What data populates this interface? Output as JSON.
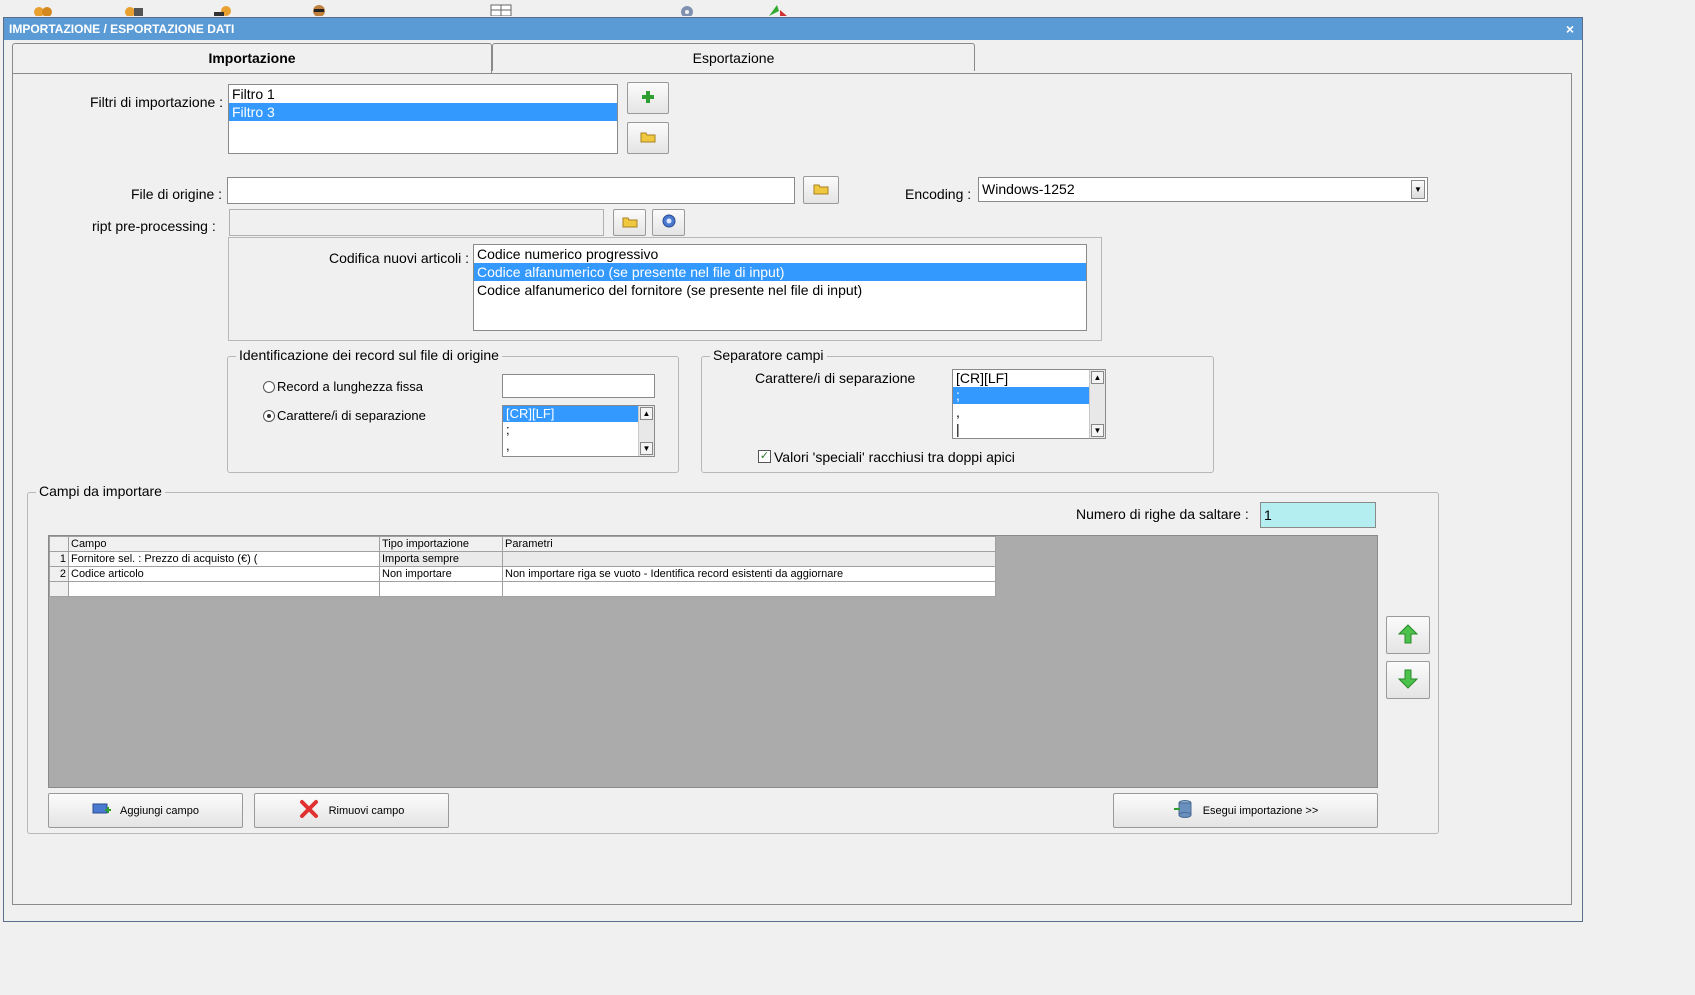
{
  "window": {
    "title": "IMPORTAZIONE / ESPORTAZIONE DATI",
    "close_label": "×"
  },
  "tabs": [
    {
      "label": "Importazione",
      "active": true
    },
    {
      "label": "Esportazione",
      "active": false
    }
  ],
  "filters": {
    "label": "Filtri di importazione :",
    "items": [
      "Filtro 1",
      "Filtro 3"
    ],
    "selected_index": 1
  },
  "source_file": {
    "label": "File di origine :",
    "value": ""
  },
  "encoding": {
    "label": "Encoding :",
    "value": "Windows-1252"
  },
  "script": {
    "label": "ript pre-processing :",
    "value": ""
  },
  "codifica": {
    "label": "Codifica nuovi articoli :",
    "items": [
      "Codice numerico progressivo",
      "Codice alfanumerico (se presente nel file di input)",
      "Codice alfanumerico del fornitore (se presente nel file di input)"
    ],
    "selected_index": 1
  },
  "record_identification": {
    "legend": "Identificazione dei record sul file di origine",
    "fixed_length_label": "Record a lunghezza fissa",
    "fixed_length_value": "",
    "separator_label": "Carattere/i di separazione",
    "separator_selected": true,
    "separator_items": [
      "[CR][LF]",
      ";",
      ","
    ],
    "separator_selected_index": 0
  },
  "field_separator": {
    "legend": "Separatore campi",
    "label": "Carattere/i di separazione",
    "items": [
      "[CR][LF]",
      ";",
      ",",
      "|"
    ],
    "selected_index": 1,
    "quotes_label": "Valori 'speciali' racchiusi tra doppi apici",
    "quotes_checked": true
  },
  "fields": {
    "legend": "Campi da importare",
    "skip_rows_label": "Numero di righe da saltare :",
    "skip_rows_value": "1",
    "columns": [
      "Campo",
      "Tipo importazione",
      "Parametri"
    ],
    "rows": [
      {
        "n": "1",
        "campo": "Fornitore sel. : Prezzo di acquisto (€) (",
        "tipo": "Importa sempre",
        "parametri": ""
      },
      {
        "n": "2",
        "campo": "Codice articolo",
        "tipo": "Non importare",
        "parametri": "Non importare riga se vuoto - Identifica record esistenti da aggiornare"
      },
      {
        "n": "",
        "campo": "",
        "tipo": "",
        "parametri": ""
      }
    ]
  },
  "buttons": {
    "add_field": "Aggiungi campo",
    "remove_field": "Rimuovi campo",
    "run_import": "Esegui importazione >>"
  },
  "colors": {
    "titlebar": "#5b9bd5",
    "selection": "#3399ff",
    "skip_rows_bg": "#b4eef0",
    "grid_bg": "#ababab"
  }
}
